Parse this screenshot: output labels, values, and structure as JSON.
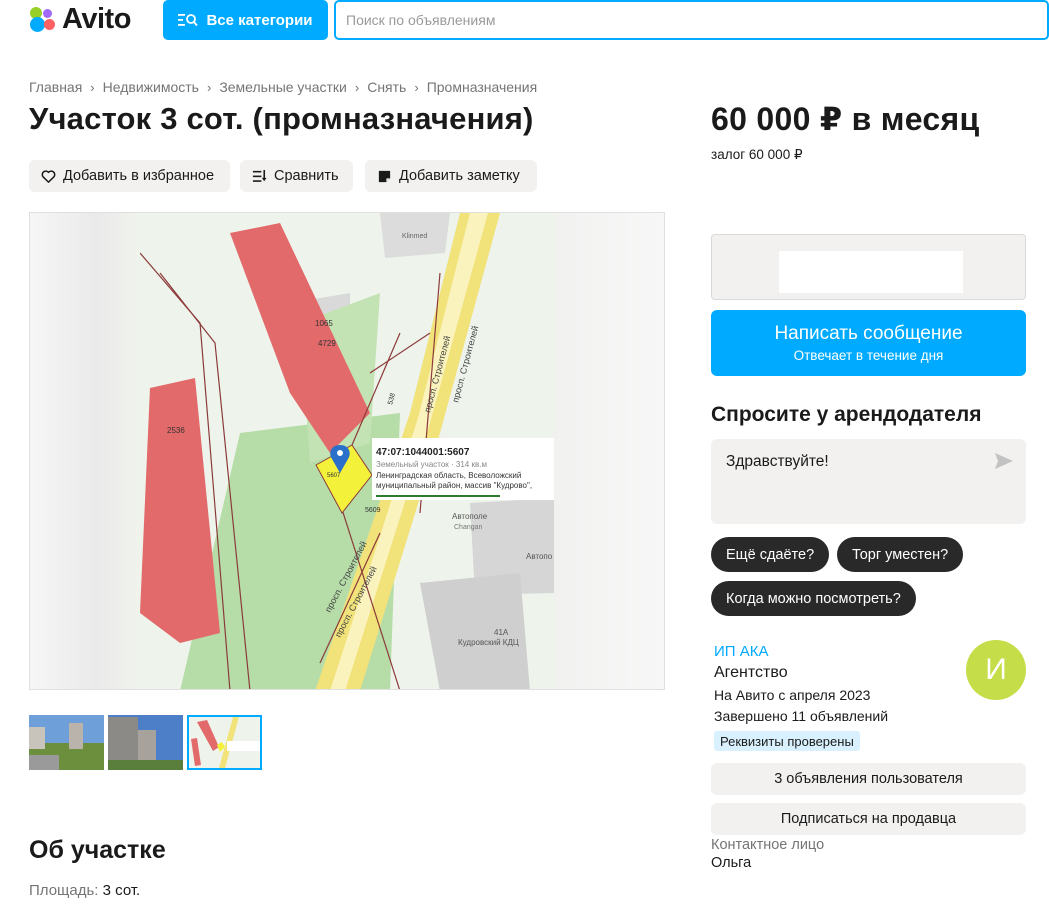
{
  "header": {
    "logo_text": "Avito",
    "all_categories_label": "Все категории",
    "search_placeholder": "Поиск по объявлениям"
  },
  "breadcrumb": [
    "Главная",
    "Недвижимость",
    "Земельные участки",
    "Снять",
    "Промназначения"
  ],
  "listing": {
    "title": "Участок 3 сот. (промназначения)",
    "actions": {
      "favorite": "Добавить в избранное",
      "compare": "Сравнить",
      "note": "Добавить заметку"
    },
    "map_labels": {
      "cadastral_number": "47:07:1044001:5607",
      "parcel_type": "Земельный участок · 314 кв.м",
      "address_line1": "Ленинградская область, Всеволожский",
      "address_line2": "муниципальный район, массив \"Кудрово\",",
      "street": "просп. Строителей",
      "building_1065": "1065",
      "building_4729": "4729",
      "building_2536": "2536",
      "num_538": "538",
      "num_5609": "5609",
      "num_5607": "5607",
      "kirmed": "Klinmed",
      "autopole_1": "Автополе",
      "autopole_2": "Changan",
      "autopole_3": "Автопо",
      "num_41a": "41А",
      "kudrovo_kdc": "Кудровский КДЦ"
    },
    "thumbnails_count": 3,
    "about_title": "Об участке",
    "area_label": "Площадь:",
    "area_value": "3 сот."
  },
  "sidebar": {
    "price": "60 000 ₽ в месяц",
    "deposit": "залог 60 000 ₽",
    "message_button": "Написать сообщение",
    "message_sub": "Отвечает в течение дня",
    "ask_title": "Спросите у арендодателя",
    "ask_text": "Здравствуйте!",
    "chips": [
      "Ещё сдаёте?",
      "Торг уместен?",
      "Когда можно посмотреть?"
    ],
    "seller": {
      "name": "ИП АКА",
      "type": "Агентство",
      "since": "На Авито с апреля 2023",
      "completed": "Завершено 11 объявлений",
      "badge": "Реквизиты проверены",
      "avatar_letter": "И"
    },
    "user_ads_button": "3 объявления пользователя",
    "subscribe_button": "Подписаться на продавца",
    "contact_label": "Контактное лицо",
    "contact_name": "Ольга"
  },
  "colors": {
    "brand_blue": "#00aaff",
    "avatar_bg": "#c4dd48",
    "chip_bg": "#292929"
  }
}
